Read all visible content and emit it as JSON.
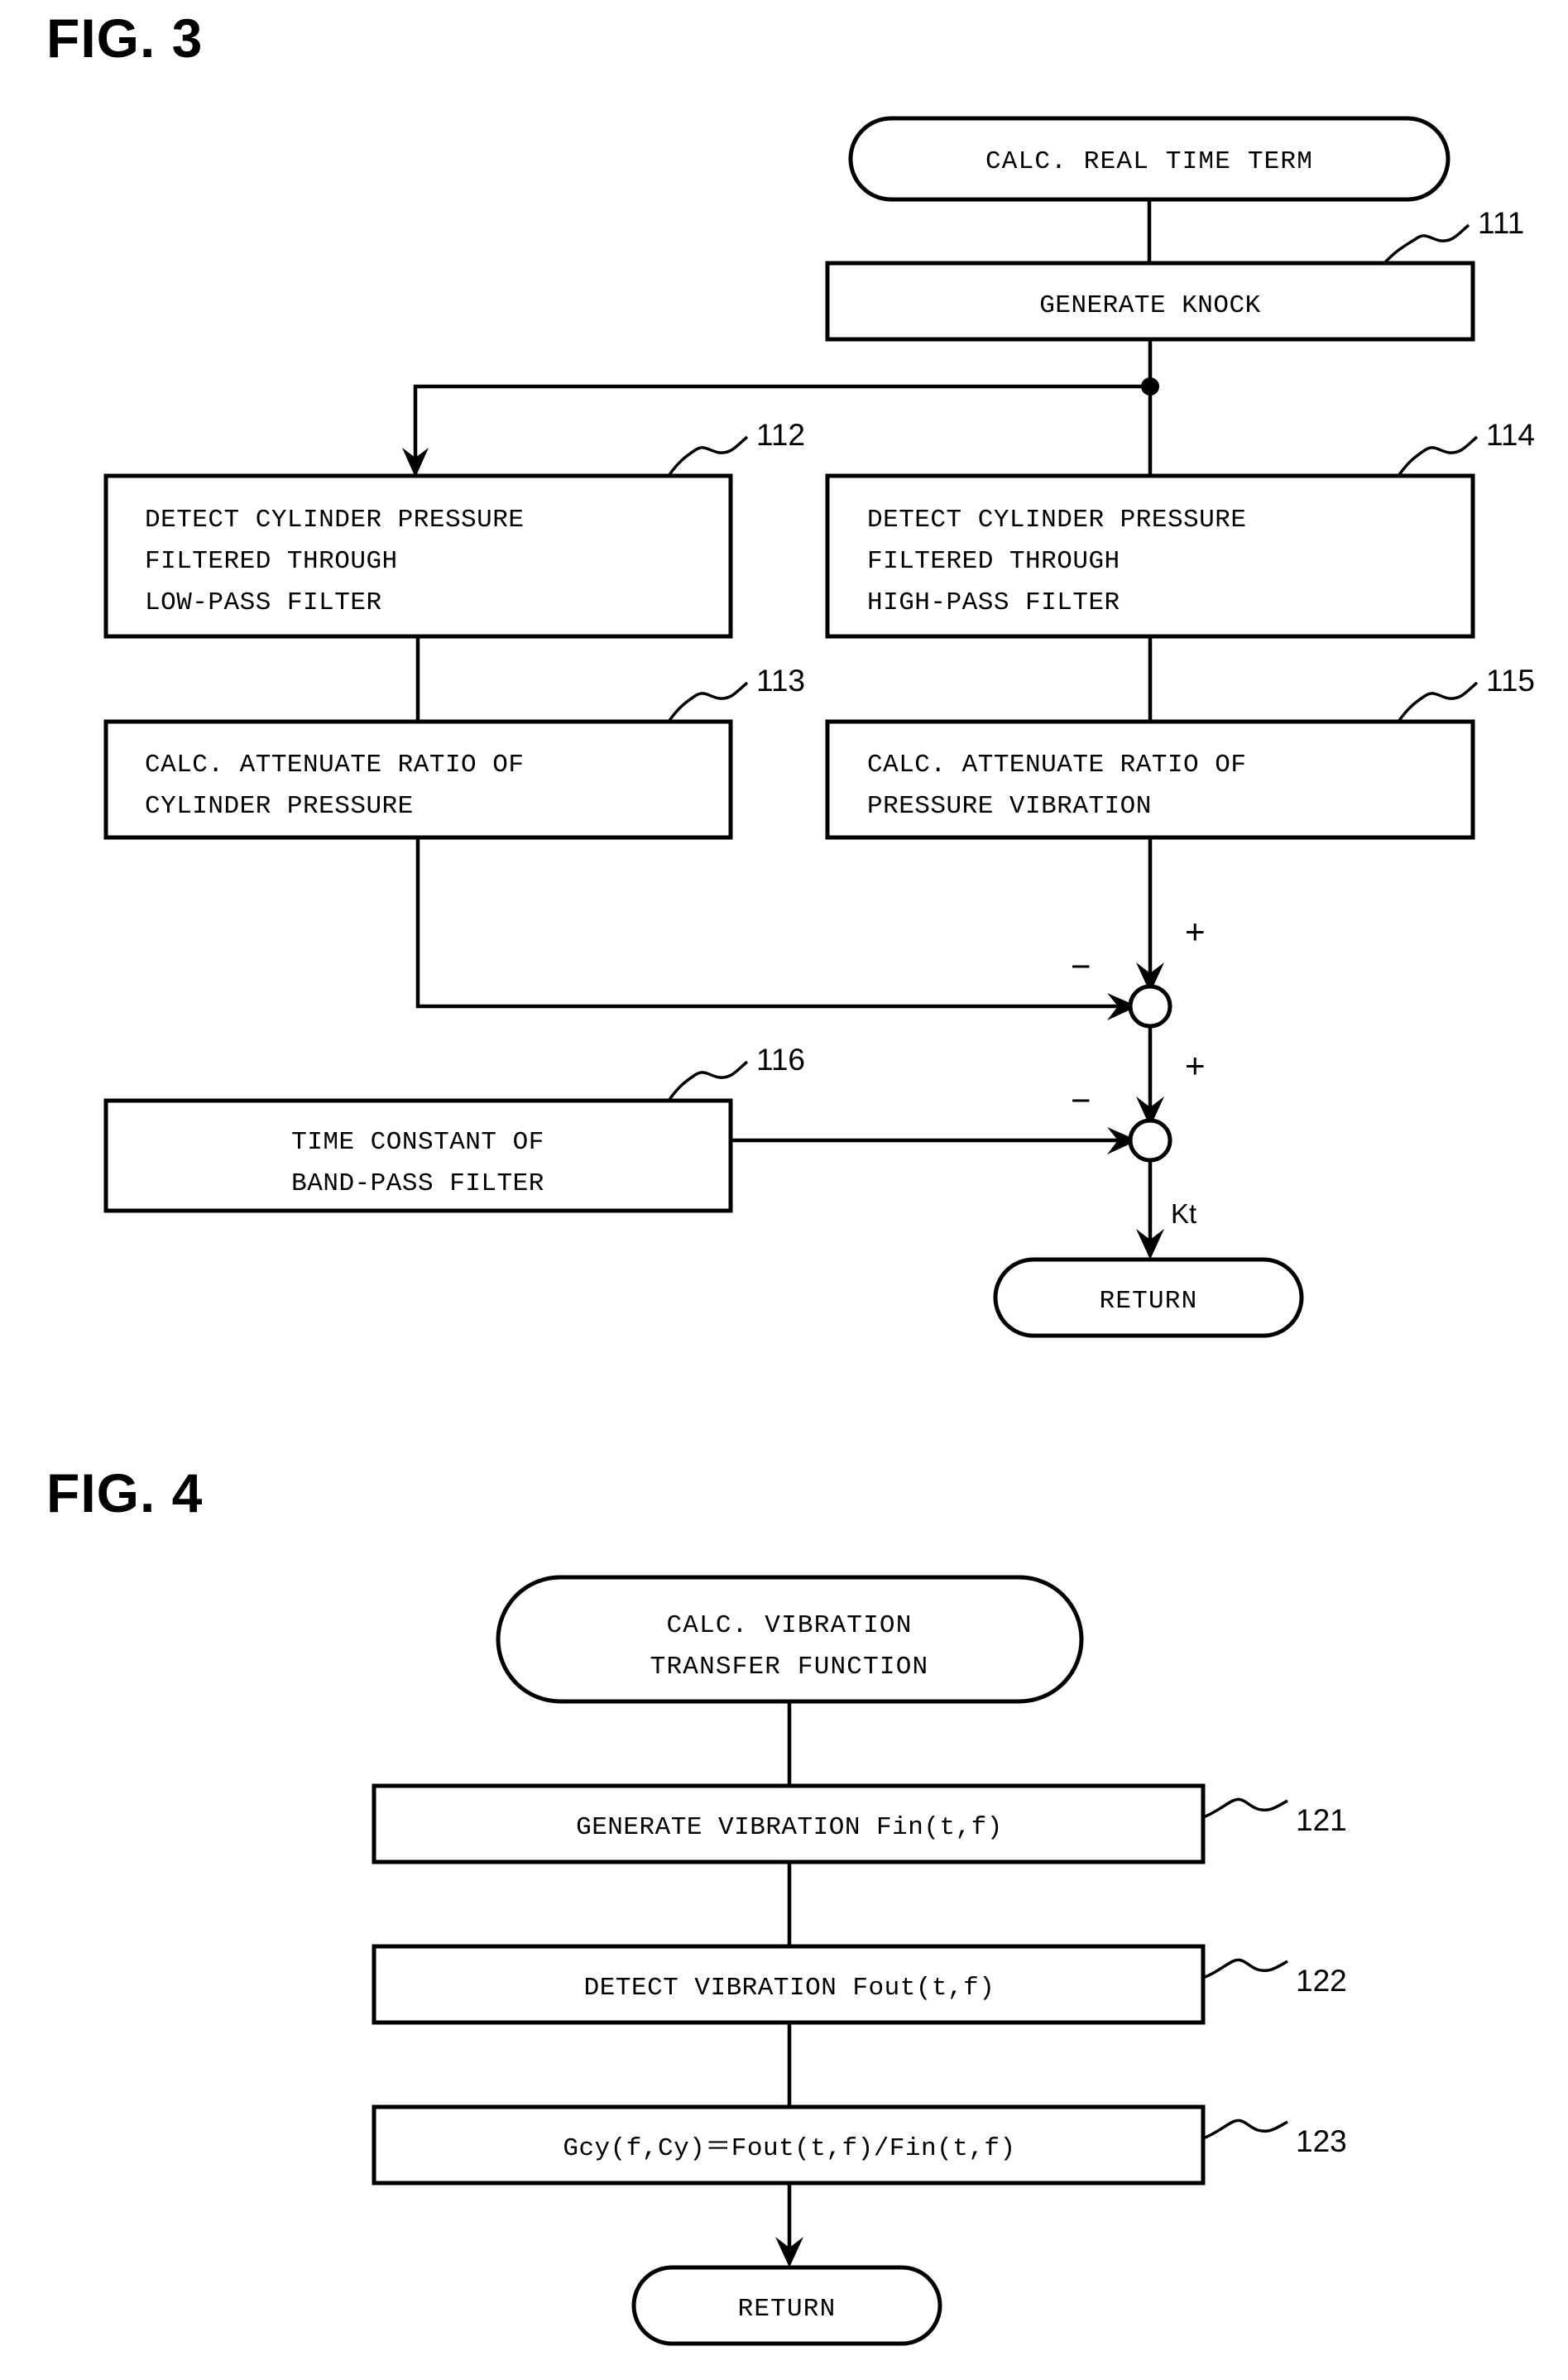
{
  "figures": [
    {
      "id": "fig3",
      "title": "FIG. 3",
      "start_terminal": "CALC. REAL TIME TERM",
      "end_terminal": "RETURN",
      "output_label": "Kt",
      "sign_plus": "+",
      "sign_minus": "−",
      "boxes": [
        {
          "ref": "111",
          "lines": [
            "GENERATE KNOCK"
          ]
        },
        {
          "ref": "112",
          "lines": [
            "DETECT CYLINDER PRESSURE",
            "FILTERED THROUGH",
            "LOW-PASS FILTER"
          ]
        },
        {
          "ref": "113",
          "lines": [
            "CALC. ATTENUATE RATIO OF",
            "CYLINDER PRESSURE"
          ]
        },
        {
          "ref": "114",
          "lines": [
            "DETECT CYLINDER PRESSURE",
            "FILTERED THROUGH",
            "HIGH-PASS FILTER"
          ]
        },
        {
          "ref": "115",
          "lines": [
            "CALC. ATTENUATE RATIO OF",
            "PRESSURE VIBRATION"
          ]
        },
        {
          "ref": "116",
          "lines": [
            "TIME CONSTANT OF",
            "BAND-PASS FILTER"
          ]
        }
      ]
    },
    {
      "id": "fig4",
      "title": "FIG. 4",
      "start_terminal_lines": [
        "CALC. VIBRATION",
        "TRANSFER FUNCTION"
      ],
      "end_terminal": "RETURN",
      "boxes": [
        {
          "ref": "121",
          "lines": [
            "GENERATE VIBRATION Fin(t,f)"
          ]
        },
        {
          "ref": "122",
          "lines": [
            "DETECT VIBRATION Fout(t,f)"
          ]
        },
        {
          "ref": "123",
          "lines": [
            "Gcy(f,Cy)＝Fout(t,f)/Fin(t,f)"
          ]
        }
      ]
    }
  ],
  "colors": {
    "ink": "#000000",
    "paper": "#ffffff"
  }
}
